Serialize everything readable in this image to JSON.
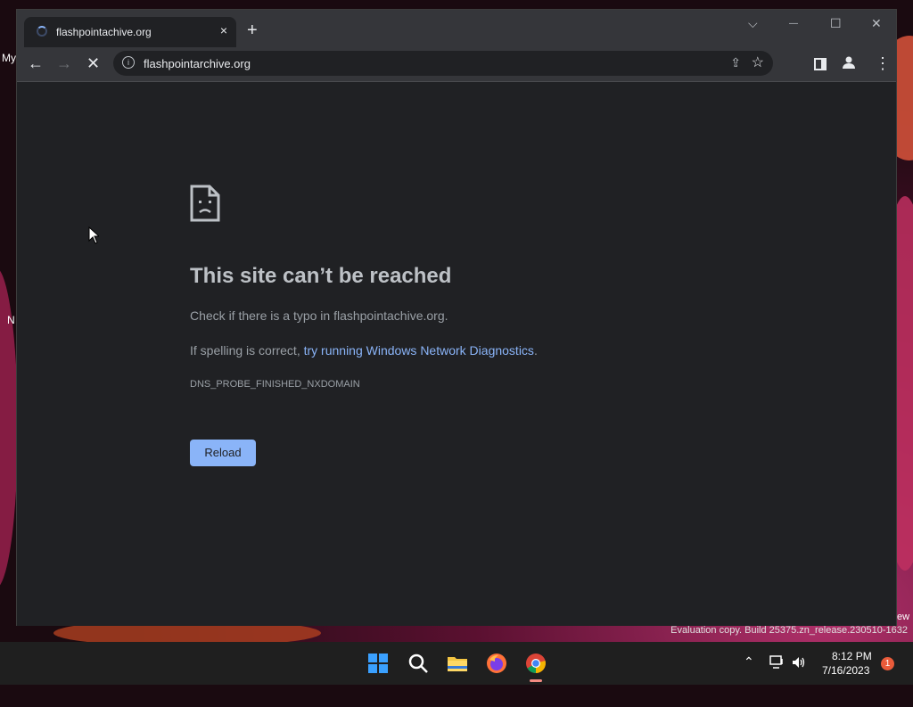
{
  "desktop": {
    "frag_my": "My",
    "frag_n": "N",
    "frag_ew": "ew"
  },
  "browser": {
    "tab_title": "flashpointachive.org",
    "tab_close": "×",
    "newtab": "+",
    "url": "flashpointarchive.org",
    "win_controls": {
      "dropdown": "⌵",
      "minimize": "—",
      "maximize": "☐",
      "close": "✕"
    }
  },
  "error": {
    "title": "This site can’t be reached",
    "line1": "Check if there is a typo in flashpointachive.org.",
    "line2_prefix": "If spelling is correct, ",
    "line2_link": "try running Windows Network Diagnostics",
    "line2_suffix": ".",
    "code": "DNS_PROBE_FINISHED_NXDOMAIN",
    "reload_label": "Reload"
  },
  "taskbar": {
    "time": "8:12 PM",
    "date": "7/16/2023",
    "notification_count": "1",
    "watermark": "Evaluation copy. Build 25375.zn_release.230510-1632"
  },
  "colors": {
    "accent": "#8ab4f8",
    "background": "#202124",
    "chrome": "#35363a"
  }
}
